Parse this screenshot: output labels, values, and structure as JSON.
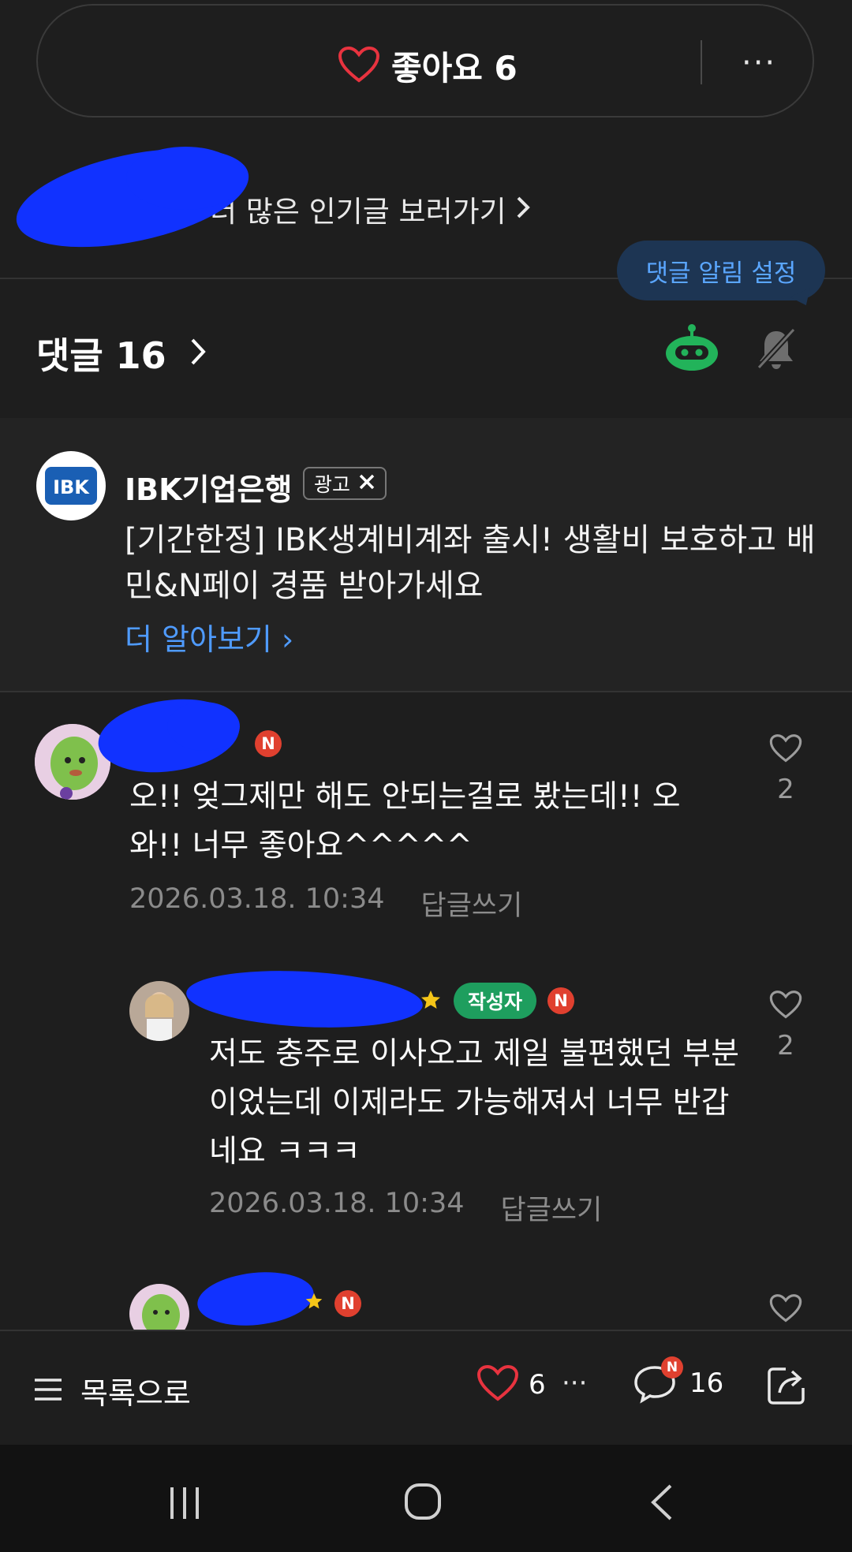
{
  "like_bar": {
    "label": "좋아요 6",
    "more": "···"
  },
  "popular_link": {
    "label": "더 많은 인기글 보러가기"
  },
  "tooltip": {
    "label": "댓글 알림 설정"
  },
  "comments_header": {
    "label": "댓글 16"
  },
  "ad": {
    "logo_text": "IBK",
    "advertiser": "IBK기업은행",
    "badge": "광고",
    "body": "[기간한정] IBK생계비계좌 출시! 생활비 보호하고 배민&N페이 경품 받아가세요",
    "link": "더 알아보기"
  },
  "comments": [
    {
      "badge_n": "N",
      "body": "오!! 엊그제만 해도 안되는걸로 봤는데!! 오와!! 너무 좋아요^^^^^",
      "date": "2026.03.18. 10:34",
      "reply": "답글쓰기",
      "likes": "2"
    },
    {
      "author_badge": "작성자",
      "badge_n": "N",
      "body": "저도 충주로 이사오고 제일 불편했던 부분이었는데 이제라도 가능해져서 너무 반갑네요 ㅋㅋㅋ",
      "date": "2026.03.18. 10:34",
      "reply": "답글쓰기",
      "likes": "2"
    },
    {
      "badge_n": "N"
    }
  ],
  "bottom_bar": {
    "list_label": "목록으로",
    "like_count": "6",
    "more": "···",
    "comment_badge": "N",
    "comment_count": "16"
  },
  "colors": {
    "accent_blue": "#4f9bff",
    "author_green": "#1e9e5e",
    "new_red": "#e0402f",
    "heart_red": "#e8333f"
  }
}
